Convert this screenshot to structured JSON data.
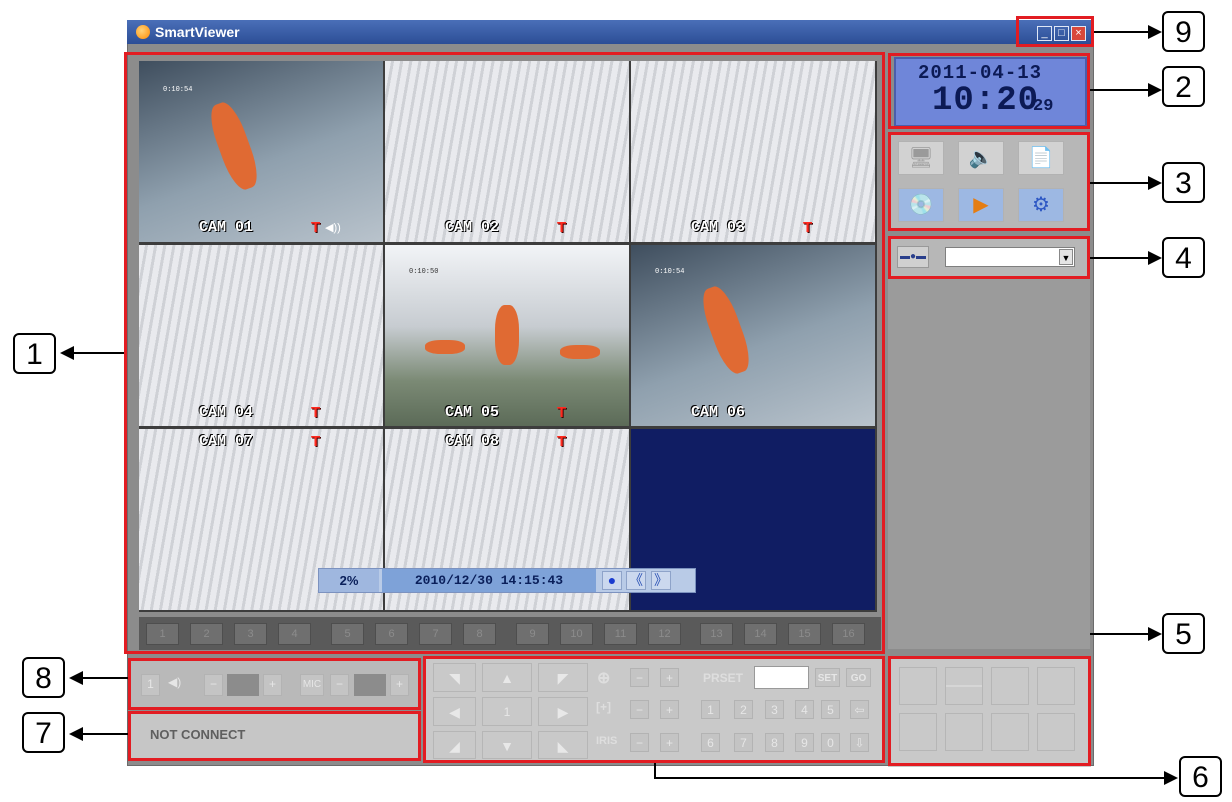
{
  "window": {
    "title": "SmartViewer",
    "minimize": "_",
    "maximize": "□",
    "close": "×"
  },
  "cameras": [
    {
      "label": "CAM 01",
      "mark": "T",
      "audio": "◀))",
      "timestamp": "0:10:54"
    },
    {
      "label": "CAM 02",
      "mark": "T"
    },
    {
      "label": "CAM 03",
      "mark": "T"
    },
    {
      "label": "CAM 04",
      "mark": "T"
    },
    {
      "label": "CAM 05",
      "mark": "T",
      "timestamp": "0:10:50"
    },
    {
      "label": "CAM 06",
      "mark": "T",
      "timestamp": "0:10:54"
    },
    {
      "label": "CAM 07",
      "mark": "T"
    },
    {
      "label": "CAM 08",
      "mark": "T"
    }
  ],
  "playback": {
    "percent": "2%",
    "datetime": "2010/12/30 14:15:43",
    "record": "●",
    "prev": "《",
    "next": "》"
  },
  "channels": [
    "1",
    "2",
    "3",
    "4",
    "5",
    "6",
    "7",
    "8",
    "9",
    "10",
    "11",
    "12",
    "13",
    "14",
    "15",
    "16"
  ],
  "clock": {
    "date": "2011-04-13",
    "time": "10:20",
    "seconds": "29"
  },
  "functions": {
    "monitor": "🖥",
    "speaker": "🔈",
    "log": "📄",
    "disk": "💿",
    "play": "▶",
    "settings": "⚙"
  },
  "connection": {
    "icon": "plug-icon",
    "selected": ""
  },
  "audio": {
    "channel": "1",
    "speaker": "◀)",
    "minus": "−",
    "plus": "+",
    "mic": "MIC"
  },
  "status": {
    "text": "NOT CONNECT"
  },
  "ptz": {
    "center": "1",
    "zoom": "⊕",
    "focus": "[+]",
    "iris": "IRIS",
    "minus": "−",
    "plus": "+",
    "preset_label": "PRSET",
    "preset_value": "",
    "set": "SET",
    "go": "GO",
    "numbers": [
      "1",
      "2",
      "3",
      "4",
      "5",
      "6",
      "7",
      "8",
      "9",
      "0"
    ],
    "back": "⇦",
    "down": "⇩"
  },
  "callouts": [
    "1",
    "2",
    "3",
    "4",
    "5",
    "6",
    "7",
    "8",
    "9"
  ]
}
